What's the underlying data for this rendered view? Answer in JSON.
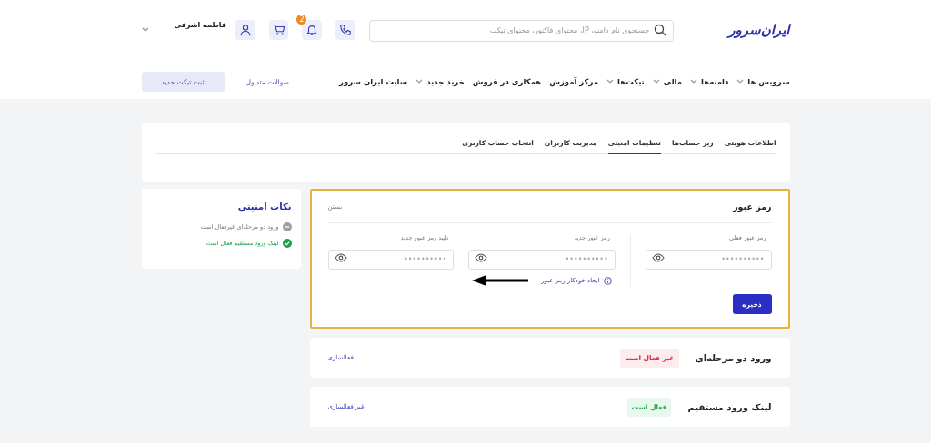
{
  "header": {
    "logo": "ایران‌سرور",
    "search": {
      "placeholder": "جستجوی نام دامنه، IP، محتوای فاکتور، محتوای تیکت"
    },
    "notification_count": "2",
    "user_name": "فاطمه اشرفی"
  },
  "nav": {
    "items": [
      {
        "label": "سرویس ها",
        "has_menu": true
      },
      {
        "label": "دامنه‌ها",
        "has_menu": true
      },
      {
        "label": "مالی",
        "has_menu": true
      },
      {
        "label": "تیکت‌ها",
        "has_menu": true
      },
      {
        "label": "مرکز آموزش",
        "has_menu": false
      },
      {
        "label": "همکاری در فروش",
        "has_menu": false
      },
      {
        "label": "خرید جدید",
        "has_menu": true
      },
      {
        "label": "سایت ایران سرور",
        "has_menu": false
      }
    ],
    "faq_link": "سوالات متداول",
    "new_ticket_button": "ثبت تیکت جدید"
  },
  "tabs": [
    {
      "label": "اطلاعات هویتی",
      "selected": false
    },
    {
      "label": "زیر حساب‌ها",
      "selected": false
    },
    {
      "label": "تنظیمات امنیتی",
      "selected": true
    },
    {
      "label": "مدیریت کاربران",
      "selected": false
    },
    {
      "label": "انتخاب حساب کاربری",
      "selected": false
    }
  ],
  "password_card": {
    "title": "رمز عبور",
    "close": "بستن",
    "fields": [
      {
        "label": "رمز عبور فعلی",
        "placeholder": "••••••••••"
      },
      {
        "label": "رمز عبور جدید",
        "placeholder": "••••••••••"
      },
      {
        "label": "تایید رمز عبور جدید",
        "placeholder": "••••••••••"
      }
    ],
    "generate_link": "ایجاد خودکار رمز عبور",
    "save_button": "ذخیره"
  },
  "security_settings": [
    {
      "title": "ورود دو مرحله‌ای",
      "status": "غیر فعال است",
      "active": false,
      "action": "فعالسازی"
    },
    {
      "title": "لینک ورود مستقیم",
      "status": "فعال است",
      "active": true,
      "action": "غیر فعالسازی"
    }
  ],
  "security_tips": {
    "title": "نکات امنیتی",
    "items": [
      {
        "text": "ورود دو مرحله‌ای غیرفعال است",
        "active": false
      },
      {
        "text": "لینک ورود مستقیم فعال است",
        "active": true
      }
    ]
  }
}
